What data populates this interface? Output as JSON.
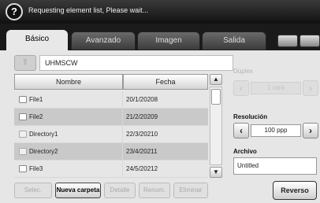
{
  "status": {
    "message": "Requesting element list, Please wait..."
  },
  "tabs": [
    {
      "label": "Básico"
    },
    {
      "label": "Avanzado"
    },
    {
      "label": "Imagen"
    },
    {
      "label": "Salida"
    }
  ],
  "path": {
    "value": "UHMSCW"
  },
  "table": {
    "headers": [
      "Nombre",
      "Fecha"
    ],
    "rows": [
      {
        "name": "File1",
        "date": "20/1/20208",
        "type": "file"
      },
      {
        "name": "File2",
        "date": "21/2/20209",
        "type": "file"
      },
      {
        "name": "Directory1",
        "date": "22/3/20210",
        "type": "dir"
      },
      {
        "name": "Directory2",
        "date": "23/4/20211",
        "type": "dir"
      },
      {
        "name": "File3",
        "date": "24/5/20212",
        "type": "file"
      }
    ]
  },
  "buttons": {
    "select": "Selec.",
    "new_folder": "Nueva carpeta",
    "detail": "Detalle",
    "rename": "Renom.",
    "delete": "Eliminar",
    "reverse": "Reverso"
  },
  "options": {
    "duplex_label": "Dúplex",
    "duplex_value": "1 cara",
    "resolution_label": "Resolución",
    "resolution_value": "100 ppp",
    "archive_label": "Archivo",
    "archive_value": "Untitled"
  }
}
